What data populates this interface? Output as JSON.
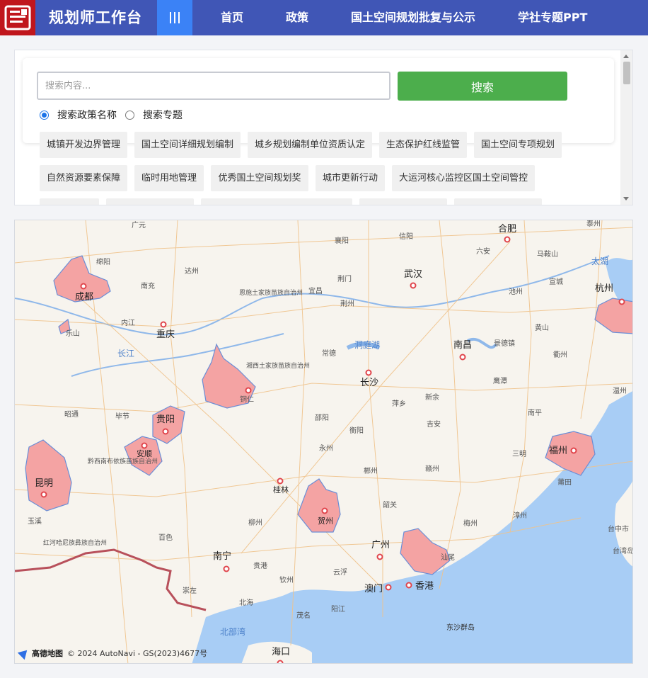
{
  "header": {
    "logo_name": "logo-icon",
    "title": "规划师工作台",
    "nav": [
      "首页",
      "政策",
      "国土空间规划批复与公示",
      "学社专题PPT"
    ]
  },
  "search": {
    "placeholder": "搜索内容...",
    "button_label": "搜索",
    "options": [
      "搜索政策名称",
      "搜索专题"
    ],
    "selected_option": "搜索政策名称"
  },
  "tags": [
    "城镇开发边界管理",
    "国土空间详细规划编制",
    "城乡规划编制单位资质认定",
    "生态保护红线监管",
    "国土空间专项规划",
    "自然资源要素保障",
    "临时用地管理",
    "优秀国土空间规划奖",
    "城市更新行动",
    "大运河核心监控区国土空间管控"
  ],
  "colors": {
    "header_bg": "#4056b6",
    "logo_bg": "#c0161c",
    "menu_toggle_bg": "#3b82f6",
    "search_button": "#4cae4c",
    "highlight_region": "#f4a3a3"
  },
  "map": {
    "cities": [
      "成都",
      "重庆",
      "武汉",
      "长沙",
      "南昌",
      "贵阳",
      "安顺",
      "昆明",
      "桂林",
      "贺州",
      "广州",
      "香港",
      "澳门",
      "南宁",
      "海口",
      "福州",
      "杭州",
      "合肥"
    ],
    "small_labels": [
      "广元",
      "绵阳",
      "达州",
      "南充",
      "乐山",
      "内江",
      "襄阳",
      "信阳",
      "荆门",
      "宜昌",
      "荆州",
      "恩施土家族苗族自治州",
      "湘西土家族苗族自治州",
      "常德",
      "六安",
      "马鞍山",
      "池州",
      "宣城",
      "黄山",
      "景德镇",
      "衢州",
      "鹰潭",
      "新余",
      "萍乡",
      "吉安",
      "邵阳",
      "衡阳",
      "永州",
      "郴州",
      "赣州",
      "韶关",
      "昭通",
      "毕节",
      "黔西南布依族苗族自治州",
      "百色",
      "红河哈尼族彝族自治州",
      "玉溪",
      "柳州",
      "贵港",
      "崇左",
      "北海",
      "钦州",
      "茂名",
      "阳江",
      "云浮",
      "汕尾",
      "梅州",
      "漳州",
      "三明",
      "南平",
      "莆田",
      "台中市",
      "台湾岛",
      "温州",
      "泰州",
      "铜仁"
    ],
    "water_labels": [
      "长江",
      "洞庭湖",
      "太湖",
      "北部湾",
      "东沙群岛"
    ],
    "attribution": "© 2024 AutoNavi - GS(2023)4677号",
    "brand": "高德地图"
  }
}
